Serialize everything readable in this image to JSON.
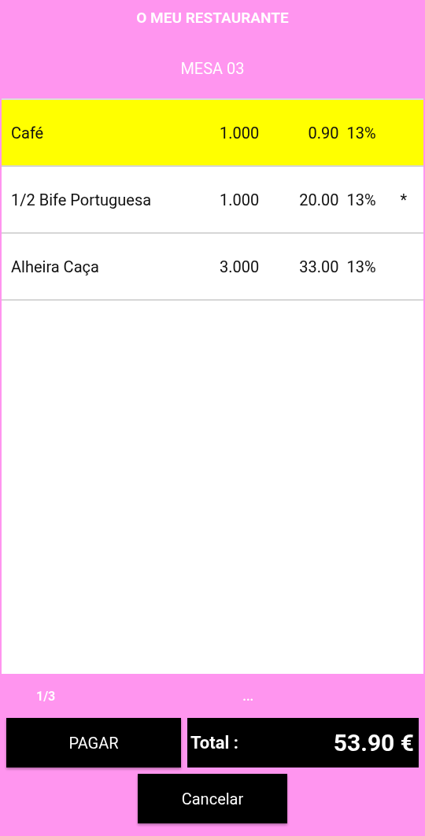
{
  "header": {
    "title": "O MEU RESTAURANTE",
    "subtitle": "MESA 03"
  },
  "items": [
    {
      "name": "Café",
      "quantity": "1.000",
      "price": "0.90",
      "tax": "13%",
      "selected": true
    },
    {
      "name": "1/2 Bife Portuguesa",
      "quantity": "1.000",
      "price": "20.00",
      "tax": "13%",
      "mark": "*",
      "selected": false
    },
    {
      "name": "Alheira Caça",
      "quantity": "3.000",
      "price": "33.00",
      "tax": "13%",
      "selected": false
    }
  ],
  "footer": {
    "page": "1/3",
    "more": "...",
    "pay_button": "PAGAR",
    "total_label": "Total :",
    "total_value": "53.90 €",
    "cancel_button": "Cancelar"
  }
}
